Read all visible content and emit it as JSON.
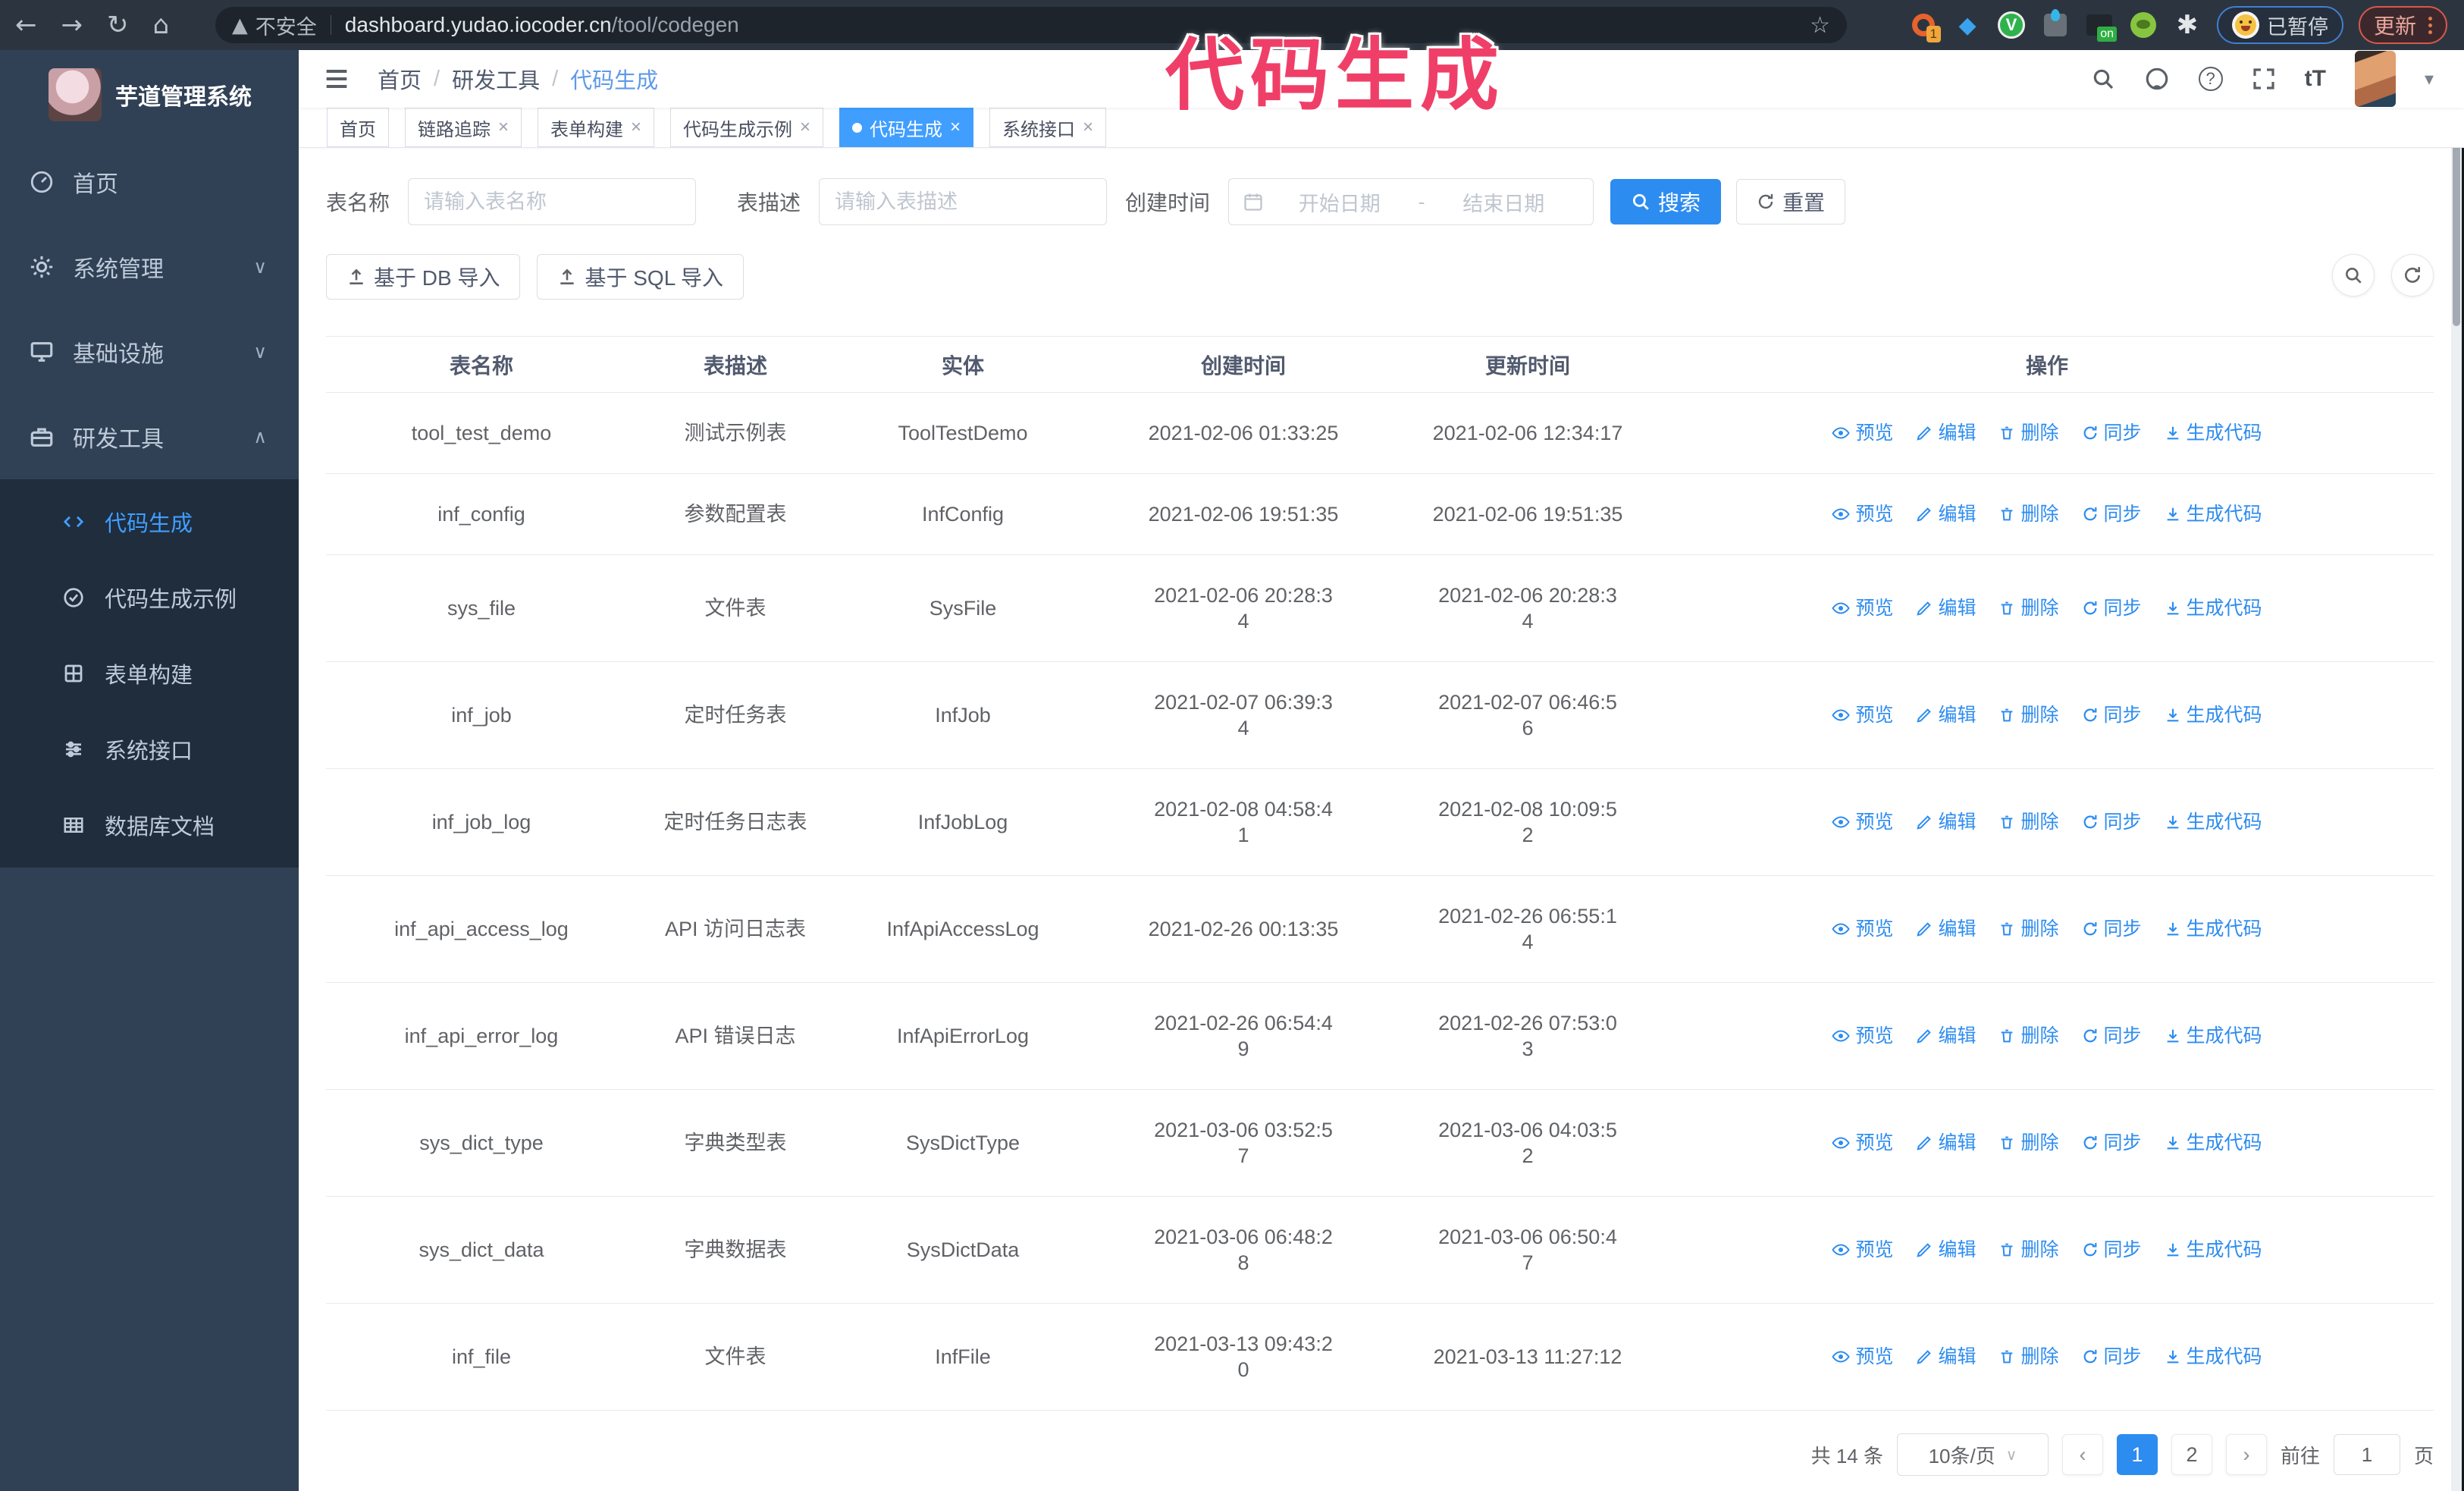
{
  "annotation": {
    "text": "代码生成"
  },
  "colors": {
    "accent": "#409eff",
    "primary_button": "#2d8cf0",
    "sidebar_bg": "#304156",
    "submenu_bg": "#1f2d3d",
    "annotation": "#ef3f68",
    "active_tab": "#409eff"
  },
  "browser": {
    "insecure_label": "不安全",
    "url_host": "dashboard.yudao.iocoder.cn",
    "url_path": "/tool/codegen",
    "ext_update_badge": "1",
    "ext_on_badge": "on",
    "paused_label": "已暂停",
    "update_label": "更新"
  },
  "sidebar": {
    "title": "芋道管理系统",
    "items": [
      {
        "label": "首页"
      },
      {
        "label": "系统管理"
      },
      {
        "label": "基础设施"
      },
      {
        "label": "研发工具"
      }
    ],
    "submenu": [
      {
        "label": "代码生成",
        "active": true
      },
      {
        "label": "代码生成示例"
      },
      {
        "label": "表单构建"
      },
      {
        "label": "系统接口"
      },
      {
        "label": "数据库文档"
      }
    ]
  },
  "breadcrumb": {
    "items": [
      "首页",
      "研发工具",
      "代码生成"
    ]
  },
  "tabs": [
    {
      "label": "首页",
      "closable": false,
      "active": false
    },
    {
      "label": "链路追踪",
      "closable": true,
      "active": false
    },
    {
      "label": "表单构建",
      "closable": true,
      "active": false
    },
    {
      "label": "代码生成示例",
      "closable": true,
      "active": false
    },
    {
      "label": "代码生成",
      "closable": true,
      "active": true
    },
    {
      "label": "系统接口",
      "closable": true,
      "active": false
    }
  ],
  "search_form": {
    "table_name_label": "表名称",
    "table_name_placeholder": "请输入表名称",
    "table_desc_label": "表描述",
    "table_desc_placeholder": "请输入表描述",
    "create_time_label": "创建时间",
    "start_date_placeholder": "开始日期",
    "range_separator": "-",
    "end_date_placeholder": "结束日期",
    "search_button": "搜索",
    "reset_button": "重置"
  },
  "toolbar": {
    "import_db_button": "基于 DB 导入",
    "import_sql_button": "基于 SQL 导入"
  },
  "table": {
    "columns": [
      "表名称",
      "表描述",
      "实体",
      "创建时间",
      "更新时间",
      "操作"
    ],
    "actions": [
      "预览",
      "编辑",
      "删除",
      "同步",
      "生成代码"
    ],
    "rows": [
      {
        "name": "tool_test_demo",
        "desc": "测试示例表",
        "entity": "ToolTestDemo",
        "created": "2021-02-06 01:33:25",
        "updated": "2021-02-06 12:34:17"
      },
      {
        "name": "inf_config",
        "desc": "参数配置表",
        "entity": "InfConfig",
        "created": "2021-02-06 19:51:35",
        "updated": "2021-02-06 19:51:35"
      },
      {
        "name": "sys_file",
        "desc": "文件表",
        "entity": "SysFile",
        "created": "2021-02-06 20:28:3\n4",
        "updated": "2021-02-06 20:28:3\n4"
      },
      {
        "name": "inf_job",
        "desc": "定时任务表",
        "entity": "InfJob",
        "created": "2021-02-07 06:39:3\n4",
        "updated": "2021-02-07 06:46:5\n6"
      },
      {
        "name": "inf_job_log",
        "desc": "定时任务日志表",
        "entity": "InfJobLog",
        "created": "2021-02-08 04:58:4\n1",
        "updated": "2021-02-08 10:09:5\n2"
      },
      {
        "name": "inf_api_access_log",
        "desc": "API 访问日志表",
        "entity": "InfApiAccessLog",
        "created": "2021-02-26 00:13:35",
        "updated": "2021-02-26 06:55:1\n4"
      },
      {
        "name": "inf_api_error_log",
        "desc": "API 错误日志",
        "entity": "InfApiErrorLog",
        "created": "2021-02-26 06:54:4\n9",
        "updated": "2021-02-26 07:53:0\n3"
      },
      {
        "name": "sys_dict_type",
        "desc": "字典类型表",
        "entity": "SysDictType",
        "created": "2021-03-06 03:52:5\n7",
        "updated": "2021-03-06 04:03:5\n2"
      },
      {
        "name": "sys_dict_data",
        "desc": "字典数据表",
        "entity": "SysDictData",
        "created": "2021-03-06 06:48:2\n8",
        "updated": "2021-03-06 06:50:4\n7"
      },
      {
        "name": "inf_file",
        "desc": "文件表",
        "entity": "InfFile",
        "created": "2021-03-13 09:43:2\n0",
        "updated": "2021-03-13 11:27:12"
      }
    ]
  },
  "pagination": {
    "total_label": "共 14 条",
    "page_size": "10条/页",
    "pages": [
      "1",
      "2"
    ],
    "active_page": "1",
    "goto_label": "前往",
    "goto_value": "1",
    "page_unit": "页"
  }
}
